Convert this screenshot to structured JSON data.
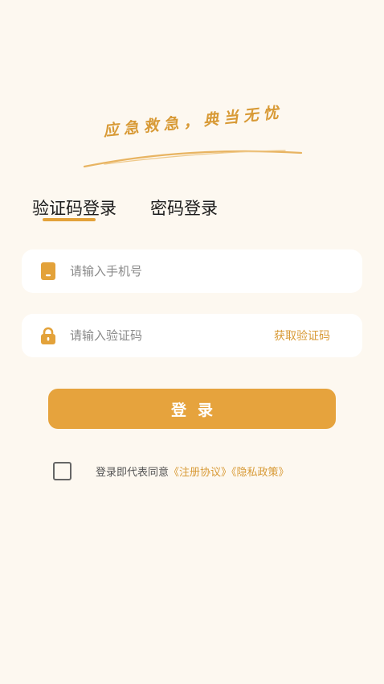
{
  "slogan": {
    "text": "应急救急，典当无忧"
  },
  "tabs": {
    "sms_login": "验证码登录",
    "password_login": "密码登录",
    "active": "sms_login"
  },
  "phone_field": {
    "placeholder": "请输入手机号",
    "value": "",
    "icon": "phone-icon"
  },
  "code_field": {
    "placeholder": "请输入验证码",
    "value": "",
    "icon": "lock-icon",
    "get_code_label": "获取验证码"
  },
  "login_button": {
    "label": "登录"
  },
  "agreement": {
    "checked": false,
    "prefix": "登录即代表同意",
    "terms_link": "《注册协议》",
    "privacy_link": "《隐私政策》"
  },
  "colors": {
    "background": "#fdf8f0",
    "accent": "#e6a33d",
    "link": "#d89a36",
    "field_bg": "#ffffff"
  }
}
